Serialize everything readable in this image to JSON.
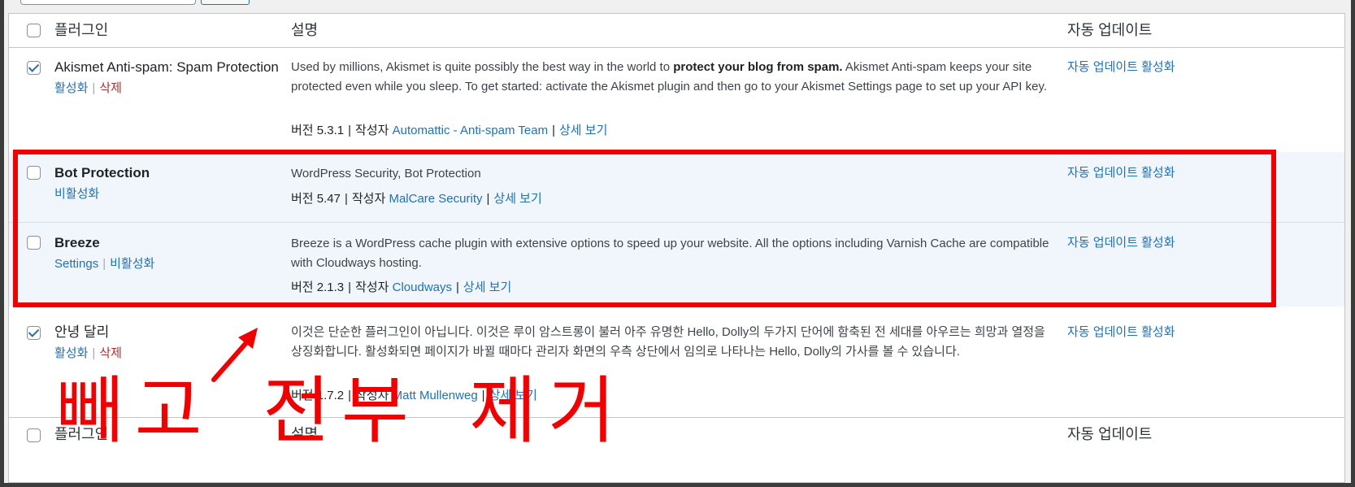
{
  "columns": {
    "plugin": "플러그인",
    "description": "설명",
    "auto_update": "자동 업데이트"
  },
  "plugins": [
    {
      "name": "Akismet Anti-spam: Spam Protection",
      "checked": true,
      "actions": [
        "활성화",
        "삭제"
      ],
      "description_pre": "Used by millions, Akismet is quite possibly the best way in the world to ",
      "description_strong": "protect your blog from spam.",
      "description_post": " Akismet Anti-spam keeps your site protected even while you sleep. To get started: activate the Akismet plugin and then go to your Akismet Settings page to set up your API key.",
      "version": "버전 5.3.1",
      "author_label": "작성자",
      "author": "Automattic - Anti-spam Team",
      "details": "상세 보기",
      "auto_update": "자동 업데이트 활성화"
    },
    {
      "name": "Bot Protection",
      "checked": false,
      "actions": [
        "비활성화"
      ],
      "description": "WordPress Security, Bot Protection",
      "version": "버전 5.47",
      "author_label": "작성자",
      "author": "MalCare Security",
      "details": "상세 보기",
      "auto_update": "자동 업데이트 활성화"
    },
    {
      "name": "Breeze",
      "checked": false,
      "actions": [
        "Settings",
        "비활성화"
      ],
      "description": "Breeze is a WordPress cache plugin with extensive options to speed up your website. All the options including Varnish Cache are compatible with Cloudways hosting.",
      "version": "버전 2.1.3",
      "author_label": "작성자",
      "author": "Cloudways",
      "details": "상세 보기",
      "auto_update": "자동 업데이트 활성화"
    },
    {
      "name": "안녕 달리",
      "checked": true,
      "actions": [
        "활성화",
        "삭제"
      ],
      "description": "이것은 단순한 플러그인이 아닙니다. 이것은 루이 암스트롱이 불러 아주 유명한 Hello, Dolly의 두가지 단어에 함축된 전 세대를 아우르는 희망과 열정을 상징화합니다. 활성화되면 페이지가 바뀔 때마다 관리자 화면의 우측 상단에서 임의로 나타나는 Hello, Dolly의 가사를 볼 수 있습니다.",
      "version": "버전 1.7.2",
      "author_label": "작성자",
      "author": "Matt Mullenweg",
      "details": "상세 보기",
      "auto_update": "자동 업데이트 활성화"
    }
  ],
  "annotation": {
    "text": "빼고 전부 제거",
    "color": "#f00000"
  },
  "colors": {
    "link": "#2271b1",
    "delete": "#b32d2e",
    "active_row": "#f0f6fc"
  }
}
